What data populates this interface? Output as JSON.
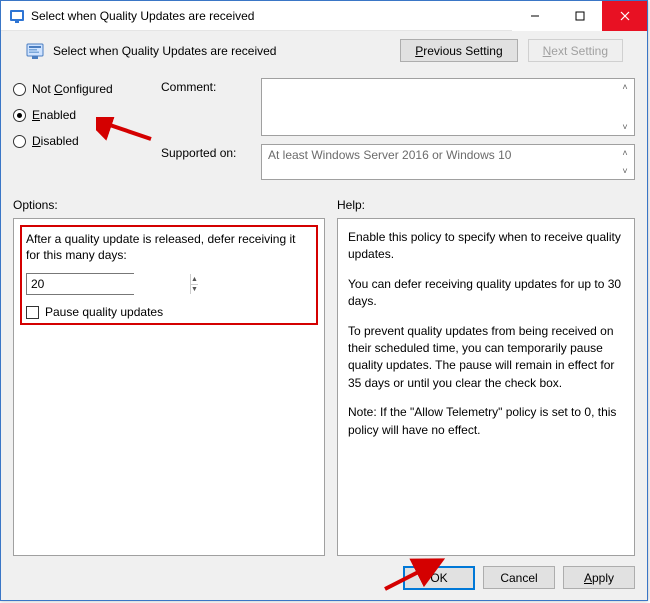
{
  "window": {
    "title": "Select when Quality Updates are received"
  },
  "header": {
    "title": "Select when Quality Updates are received",
    "previous_setting": "Previous Setting",
    "next_setting": "Next Setting"
  },
  "state": {
    "not_configured": "Not Configured",
    "enabled": "Enabled",
    "disabled": "Disabled",
    "selected": "enabled"
  },
  "form": {
    "comment_label": "Comment:",
    "comment_value": "",
    "supported_label": "Supported on:",
    "supported_value": "At least Windows Server 2016 or Windows 10"
  },
  "labels": {
    "options": "Options:",
    "help": "Help:"
  },
  "options": {
    "defer_label": "After a quality update is released, defer receiving it for this many days:",
    "defer_value": "20",
    "pause_label": "Pause quality updates",
    "pause_checked": false
  },
  "help": {
    "p1": "Enable this policy to specify when to receive quality updates.",
    "p2": "You can defer receiving quality updates for up to 30 days.",
    "p3": "To prevent quality updates from being received on their scheduled time, you can temporarily pause quality updates. The pause will remain in effect for 35 days or until you clear the check box.",
    "p4": "Note: If the \"Allow Telemetry\" policy is set to 0, this policy will have no effect."
  },
  "footer": {
    "ok": "OK",
    "cancel": "Cancel",
    "apply": "Apply"
  }
}
